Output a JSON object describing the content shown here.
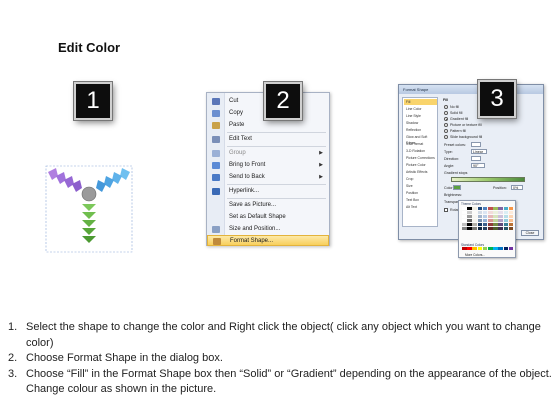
{
  "title": "Edit Color",
  "steps": [
    {
      "number": "1"
    },
    {
      "number": "2"
    },
    {
      "number": "3"
    }
  ],
  "context_menu": {
    "items": [
      {
        "label": "Cut",
        "icon": "scissors-icon",
        "color": "#5a76b8"
      },
      {
        "label": "Copy",
        "icon": "copy-icon",
        "color": "#6b8fd0"
      },
      {
        "label": "Paste",
        "icon": "paste-icon",
        "color": "#c9a24a"
      },
      {
        "label": "Edit Text",
        "icon": "edit-text-icon",
        "color": "#7a8fb8"
      },
      {
        "label": "Group",
        "icon": "group-icon",
        "color": "#9ab0d6"
      },
      {
        "label": "Bring to Front",
        "icon": "bring-front-icon",
        "color": "#5a8ad6"
      },
      {
        "label": "Send to Back",
        "icon": "send-back-icon",
        "color": "#4a7ac6"
      },
      {
        "label": "Hyperlink...",
        "icon": "hyperlink-icon",
        "color": "#3a6ab6"
      },
      {
        "label": "Save as Picture...",
        "icon": "",
        "color": ""
      },
      {
        "label": "Set as Default Shape",
        "icon": "",
        "color": ""
      },
      {
        "label": "Size and Position...",
        "icon": "size-icon",
        "color": "#8aa0c4"
      },
      {
        "label": "Format Shape...",
        "icon": "format-shape-icon",
        "color": "#c08a3a"
      }
    ]
  },
  "dialog": {
    "title": "Format Shape",
    "categories": [
      "Fill",
      "Line Color",
      "Line Style",
      "Shadow",
      "Reflection",
      "Glow and Soft Edges",
      "3-D Format",
      "3-D Rotation",
      "Picture Corrections",
      "Picture Color",
      "Artistic Effects",
      "Crop",
      "Size",
      "Position",
      "Text Box",
      "Alt Text"
    ],
    "section_heading": "Fill",
    "fill_options": [
      "No fill",
      "Solid fill",
      "Gradient fill",
      "Picture or texture fill",
      "Pattern fill",
      "Slide background fill"
    ],
    "selected_fill": "Gradient fill",
    "preset_label": "Preset colors:",
    "type_label": "Type:",
    "type_value": "Linear",
    "direction_label": "Direction:",
    "angle_label": "Angle:",
    "angle_value": "90°",
    "stops_label": "Gradient stops",
    "color_label": "Color",
    "position_label": "Position:",
    "position_value": "0%",
    "brightness_label": "Brightness:",
    "transparency_label": "Transparency:",
    "rotate_label": "Rotate with shape",
    "close_label": "Close"
  },
  "palette": {
    "theme_heading": "Theme Colors",
    "standard_heading": "Standard Colors",
    "more_label": "More Colors...",
    "theme_colors": [
      "#ffffff",
      "#000000",
      "#eeece1",
      "#1f497d",
      "#4f81bd",
      "#c0504d",
      "#9bbb59",
      "#8064a2",
      "#4bacc6",
      "#f79646"
    ],
    "standard_colors": [
      "#c00000",
      "#ff0000",
      "#ffc000",
      "#ffff00",
      "#92d050",
      "#00b050",
      "#00b0f0",
      "#0070c0",
      "#002060",
      "#7030a0"
    ]
  },
  "instructions": [
    {
      "num": "1.",
      "text": "Select the shape to change the color and Right click the object( click any object which you want to change color)"
    },
    {
      "num": "2.",
      "text": "Choose Format Shape in the dialog box."
    },
    {
      "num": "3.",
      "text": "Choose “Fill” in the Format Shape box then “Solid” or “Gradient” depending on the appearance of the object. Change colour as shown in the picture."
    }
  ],
  "diagram": {
    "left_arm_color": "#9b6fd6",
    "right_arm_color": "#5aa8e8",
    "bottom_arm_color": "#6cb84c",
    "hub_color": "#8a8a8a"
  }
}
